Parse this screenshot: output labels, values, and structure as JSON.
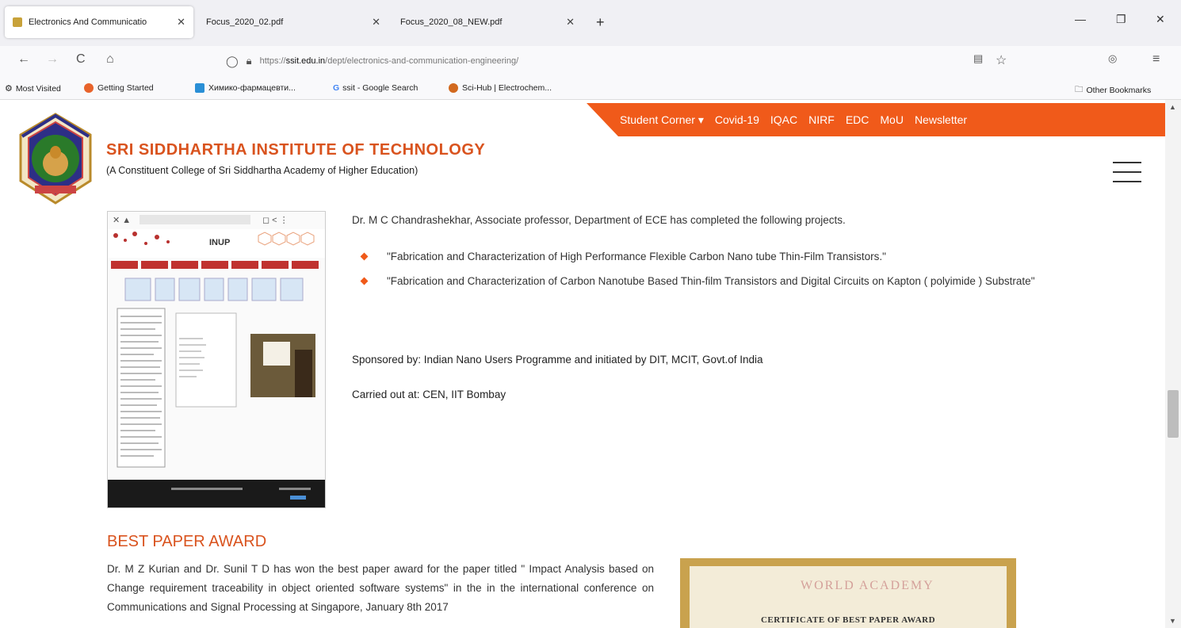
{
  "browser": {
    "tabs": [
      {
        "label": "Electronics And Communicatio",
        "active": true
      },
      {
        "label": "Focus_2020_02.pdf",
        "active": false
      },
      {
        "label": "Focus_2020_08_NEW.pdf",
        "active": false
      }
    ],
    "new_tab_symbol": "+",
    "window_controls": {
      "minimize": "—",
      "restore": "❐",
      "close": "✕"
    },
    "nav": {
      "back": "←",
      "forward": "→",
      "reload": "C",
      "home": "⌂"
    },
    "url": {
      "prefix": "https://",
      "domain": "ssit.edu.in",
      "path": "/dept/electronics-and-communication-engineering/"
    },
    "bookmarks": [
      {
        "label": "Most Visited",
        "color": "#777777"
      },
      {
        "label": "Getting Started",
        "color": "#e8632b"
      },
      {
        "label": "Химико-фармацевти...",
        "color": "#2a8fd6"
      },
      {
        "label": "ssit - Google Search",
        "color": "#4285f4"
      },
      {
        "label": "Sci-Hub | Electrochem...",
        "color": "#d2691e"
      }
    ],
    "other_bookmarks": "Other Bookmarks"
  },
  "site": {
    "top_nav": [
      "Student Corner ▾",
      "Covid-19",
      "IQAC",
      "NIRF",
      "EDC",
      "MoU",
      "Newsletter"
    ],
    "institute_name": "SRI SIDDHARTHA INSTITUTE OF TECHNOLOGY",
    "institute_sub": "(A Constituent College of Sri Siddhartha Academy of Higher Education)",
    "accent_color": "#f05a1a"
  },
  "projects": {
    "intro": "Dr. M C Chandrashekhar, Associate professor, Department of ECE has completed the following projects.",
    "items": [
      "\"Fabrication and Characterization of High Performance Flexible Carbon Nano tube Thin-Film Transistors.\"",
      "\"Fabrication and Characterization of Carbon Nanotube Based Thin-film Transistors and Digital Circuits on Kapton ( polyimide ) Substrate\""
    ],
    "sponsor": "Sponsored by: Indian Nano Users Programme and initiated by DIT, MCIT, Govt.of India",
    "carried": "Carried out at: CEN, IIT Bombay",
    "image_header": "INUP"
  },
  "award": {
    "title": "BEST PAPER AWARD",
    "text": "Dr. M Z Kurian and Dr. Sunil T D has won the best paper award for the paper titled \" Impact Analysis based on Change requirement traceability in object oriented software systems\" in the in the international conference on Communications and Signal Processing at Singapore, January 8th 2017",
    "certificate_seal": "WORLD ACADEMY",
    "certificate_title": "CERTIFICATE OF BEST PAPER AWARD"
  }
}
